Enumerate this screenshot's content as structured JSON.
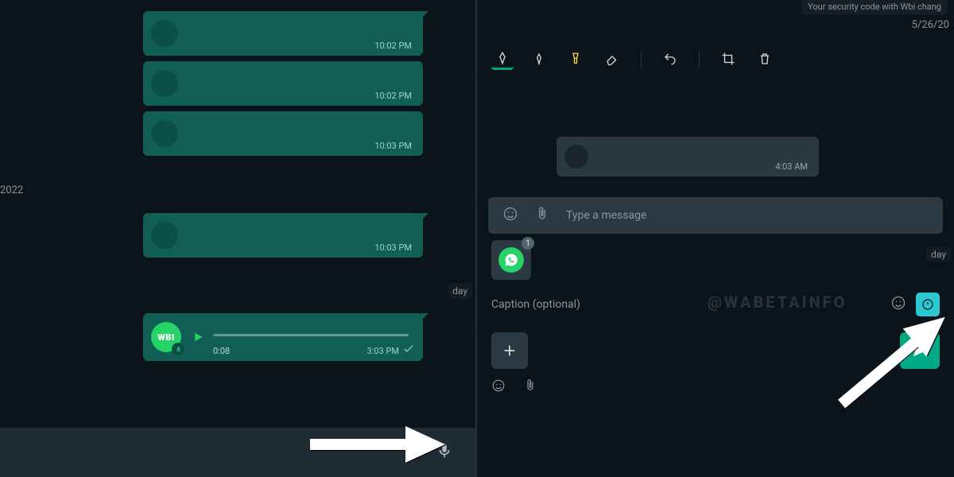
{
  "left": {
    "date_partial": "2022",
    "day_label": "day",
    "messages": [
      {
        "time": "10:02 PM"
      },
      {
        "time": "10:02 PM"
      },
      {
        "time": "10:03 PM"
      },
      {
        "time": "10:03 PM"
      }
    ],
    "voice": {
      "avatar_label": "WBI",
      "elapsed": "0:08",
      "time": "3:03 PM"
    }
  },
  "right": {
    "security_banner": "Your security code with Wbi chang",
    "date_partial": "5/26/20",
    "preview_time": "4:03 AM",
    "input_placeholder": "Type a message",
    "attach_badge": "1",
    "day_label": "day",
    "caption_placeholder": "Caption (optional)",
    "watermark": "@WABETAINFO"
  }
}
